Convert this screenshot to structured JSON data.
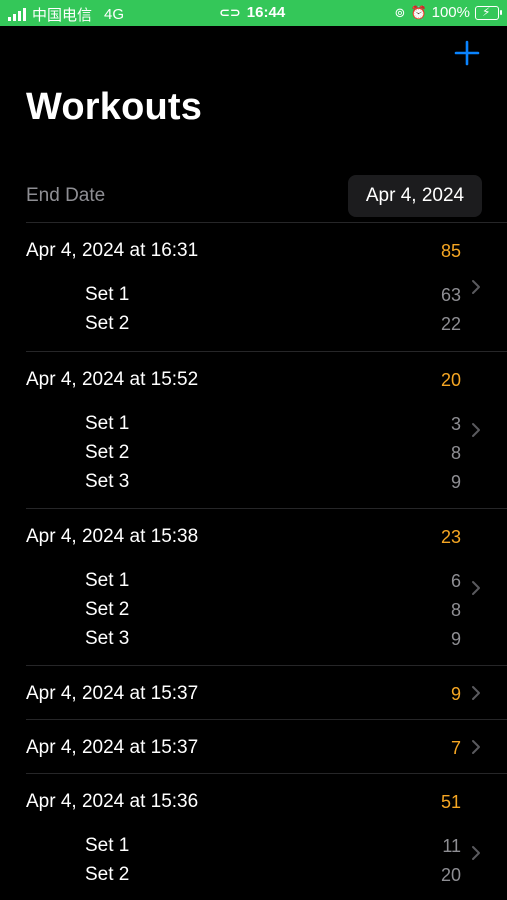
{
  "status_bar": {
    "carrier": "中国电信",
    "network": "4G",
    "time": "16:44",
    "battery": "100%"
  },
  "header": {
    "title": "Workouts",
    "add_icon": "plus-icon"
  },
  "filter": {
    "label": "End Date",
    "value": "Apr 4, 2024"
  },
  "colors": {
    "accent": "#0a84ff",
    "total": "#f5a623",
    "secondary": "#8e8e93",
    "status_bar": "#34c759"
  },
  "workouts": [
    {
      "date": "Apr 4, 2024 at 16:31",
      "total": "85",
      "sets": [
        {
          "label": "Set 1",
          "value": "63"
        },
        {
          "label": "Set 2",
          "value": "22"
        }
      ]
    },
    {
      "date": "Apr 4, 2024 at 15:52",
      "total": "20",
      "sets": [
        {
          "label": "Set 1",
          "value": "3"
        },
        {
          "label": "Set 2",
          "value": "8"
        },
        {
          "label": "Set 3",
          "value": "9"
        }
      ]
    },
    {
      "date": "Apr 4, 2024 at 15:38",
      "total": "23",
      "sets": [
        {
          "label": "Set 1",
          "value": "6"
        },
        {
          "label": "Set 2",
          "value": "8"
        },
        {
          "label": "Set 3",
          "value": "9"
        }
      ]
    },
    {
      "date": "Apr 4, 2024 at 15:37",
      "total": "9",
      "sets": []
    },
    {
      "date": "Apr 4, 2024 at 15:37",
      "total": "7",
      "sets": []
    },
    {
      "date": "Apr 4, 2024 at 15:36",
      "total": "51",
      "sets": [
        {
          "label": "Set 1",
          "value": "11"
        },
        {
          "label": "Set 2",
          "value": "20"
        }
      ]
    }
  ]
}
